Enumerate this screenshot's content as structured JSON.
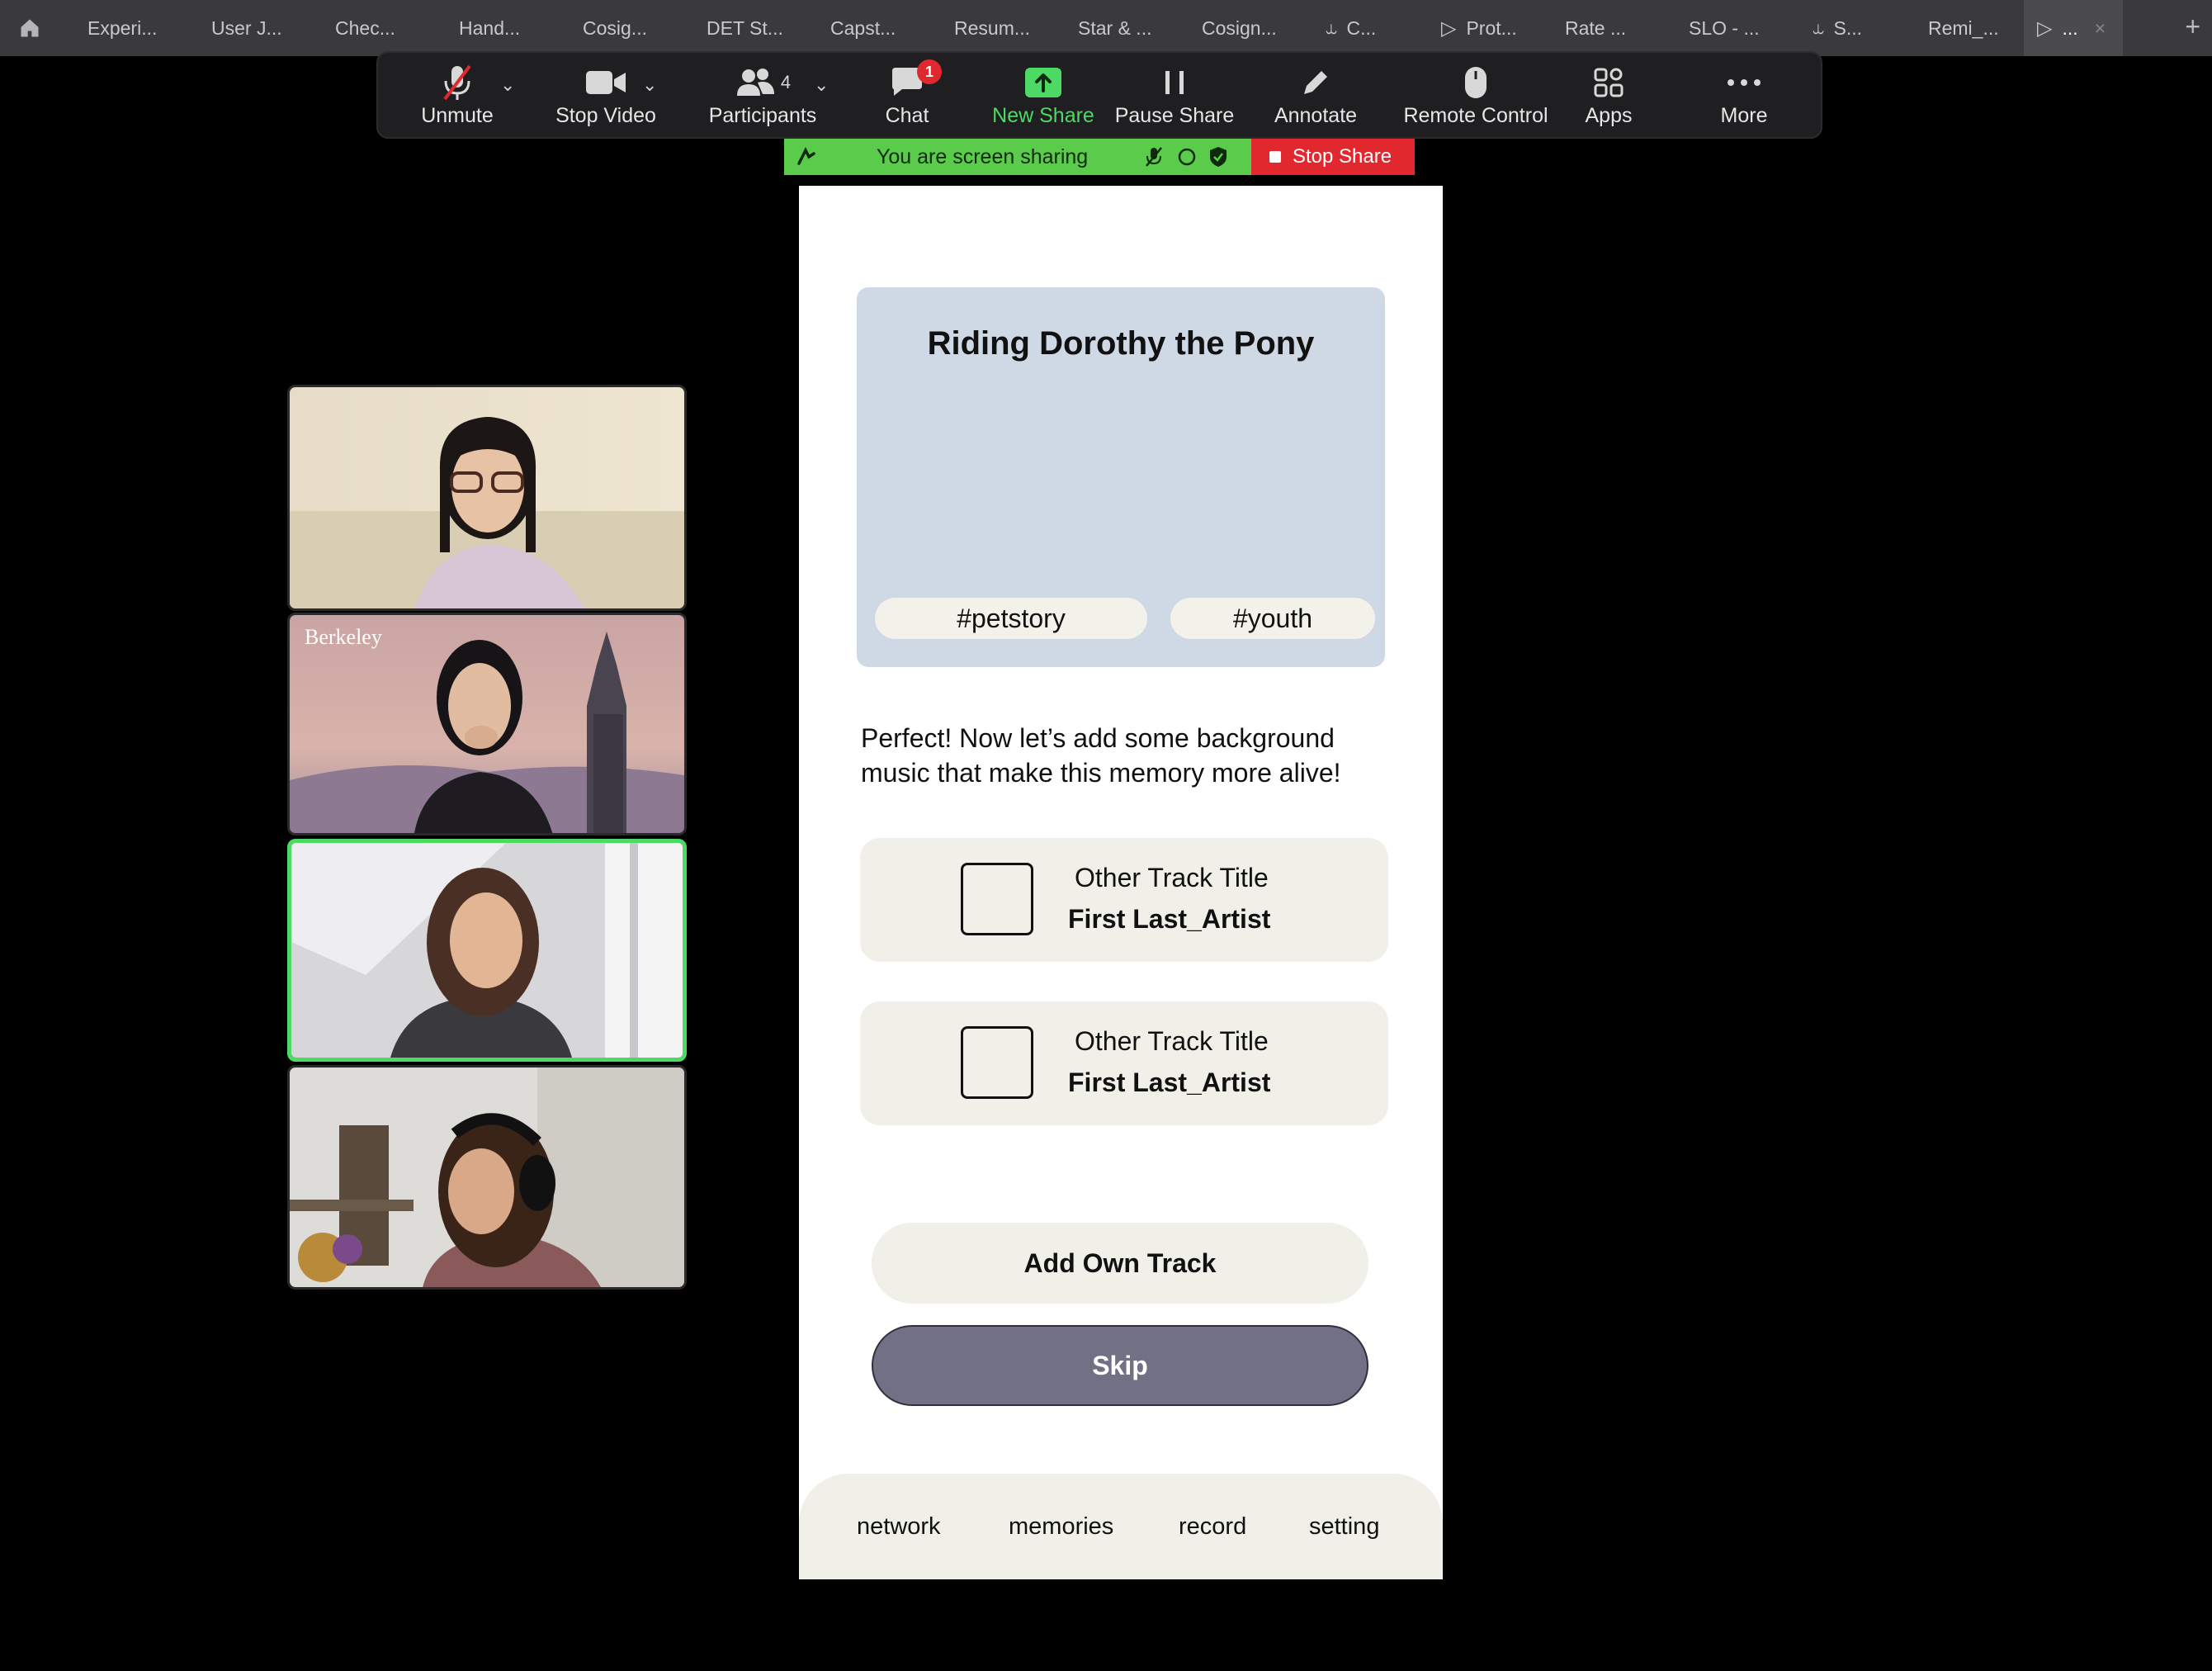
{
  "browser": {
    "tabs": [
      {
        "label": "Experi...",
        "icon": "none"
      },
      {
        "label": "User J...",
        "icon": "none"
      },
      {
        "label": "Chec...",
        "icon": "none"
      },
      {
        "label": "Hand...",
        "icon": "none"
      },
      {
        "label": "Cosig...",
        "icon": "none"
      },
      {
        "label": "DET St...",
        "icon": "none"
      },
      {
        "label": "Capst...",
        "icon": "none"
      },
      {
        "label": "Resum...",
        "icon": "none"
      },
      {
        "label": "Star & ...",
        "icon": "none"
      },
      {
        "label": "Cosign...",
        "icon": "none"
      },
      {
        "label": "C...",
        "icon": "branch-icon"
      },
      {
        "label": "Prot...",
        "icon": "play-icon"
      },
      {
        "label": "Rate ...",
        "icon": "none"
      },
      {
        "label": "SLO - ...",
        "icon": "none"
      },
      {
        "label": "S...",
        "icon": "branch-icon"
      },
      {
        "label": "Remi_...",
        "icon": "none"
      },
      {
        "label": "...",
        "icon": "play-icon",
        "active": true
      }
    ]
  },
  "zoom_toolbar": {
    "unmute": "Unmute",
    "stop_video": "Stop Video",
    "participants": "Participants",
    "participants_count": "4",
    "chat": "Chat",
    "chat_badge": "1",
    "new_share": "New Share",
    "pause_share": "Pause Share",
    "annotate": "Annotate",
    "remote_control": "Remote Control",
    "apps": "Apps",
    "more": "More"
  },
  "share_banner": {
    "text": "You are screen sharing",
    "stop": "Stop Share"
  },
  "app": {
    "memory_title": "Riding Dorothy the Pony",
    "tags": [
      "#petstory",
      "#youth"
    ],
    "prompt": "Perfect! Now let’s add some background music that make this memory more alive!",
    "tracks": [
      {
        "title": "Other Track Title",
        "artist": "First Last_Artist"
      },
      {
        "title": "Other Track Title",
        "artist": "First Last_Artist"
      }
    ],
    "add_own_track": "Add Own Track",
    "skip": "Skip",
    "nav": [
      "network",
      "memories",
      "record",
      "setting"
    ]
  },
  "colors": {
    "zoom_green": "#4cd964",
    "stop_red": "#e0282e",
    "memory_card_bg": "#cfd9e6",
    "track_bg": "#f1f0e8",
    "skip_bg": "#717085"
  }
}
